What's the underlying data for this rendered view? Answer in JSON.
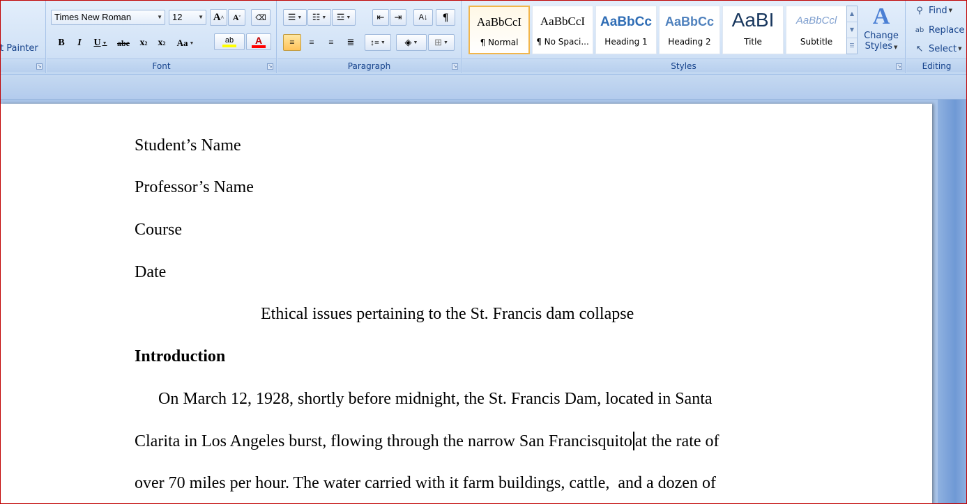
{
  "clipboard": {
    "format_painter_label": "t Painter"
  },
  "font_group": {
    "label": "Font",
    "font_name": "Times New Roman",
    "font_size": "12",
    "grow_label": "A",
    "shrink_label": "A",
    "bold": "B",
    "italic": "I",
    "underline": "U",
    "strikethrough": "abe",
    "subscript": "x",
    "superscript": "x",
    "change_case": "Aa",
    "highlight": "ab",
    "font_color": "A"
  },
  "paragraph_group": {
    "label": "Paragraph",
    "sort": "A↓",
    "pilcrow": "¶"
  },
  "styles_group": {
    "label": "Styles",
    "tiles": [
      {
        "sample": "AaBbCcI",
        "name": "¶ Normal",
        "color": "#000000"
      },
      {
        "sample": "AaBbCcI",
        "name": "¶ No Spaci...",
        "color": "#000000"
      },
      {
        "sample": "AaBbCc",
        "name": "Heading 1",
        "color": "#2f6db5"
      },
      {
        "sample": "AaBbCc",
        "name": "Heading 2",
        "color": "#4f81bd"
      },
      {
        "sample": "AaBI",
        "name": "Title",
        "color": "#17365d"
      },
      {
        "sample": "AaBbCcl",
        "name": "Subtitle",
        "color": "#7f9fcf"
      }
    ],
    "change_styles_line1": "Change",
    "change_styles_line2": "Styles"
  },
  "editing_group": {
    "label": "Editing",
    "find": "Find",
    "replace": "Replace",
    "select": "Select"
  },
  "document": {
    "lines": [
      "Student’s Name",
      "Professor’s Name",
      "Course",
      "Date"
    ],
    "title": "Ethical issues pertaining to the St. Francis dam collapse",
    "heading": "Introduction",
    "para_line1": "On March 12, 1928, shortly before midnight, the St. Francis Dam, located in Santa",
    "para_line2_before_cursor": "Clarita in Los Angeles burst, flowing through the narrow San Francisquito",
    "para_line2_after_cursor": "at the rate of",
    "para_line3": "over 70 miles per hour. The water carried with it farm buildings, cattle,  and a dozen of"
  },
  "colors": {
    "ribbon_bg": "#d4e4f7",
    "accent_text": "#15428b",
    "active_style_border": "#f2b64b",
    "font_color_bar": "#ff0000",
    "highlight_bar": "#ffff00",
    "frame_border": "#c00000"
  }
}
